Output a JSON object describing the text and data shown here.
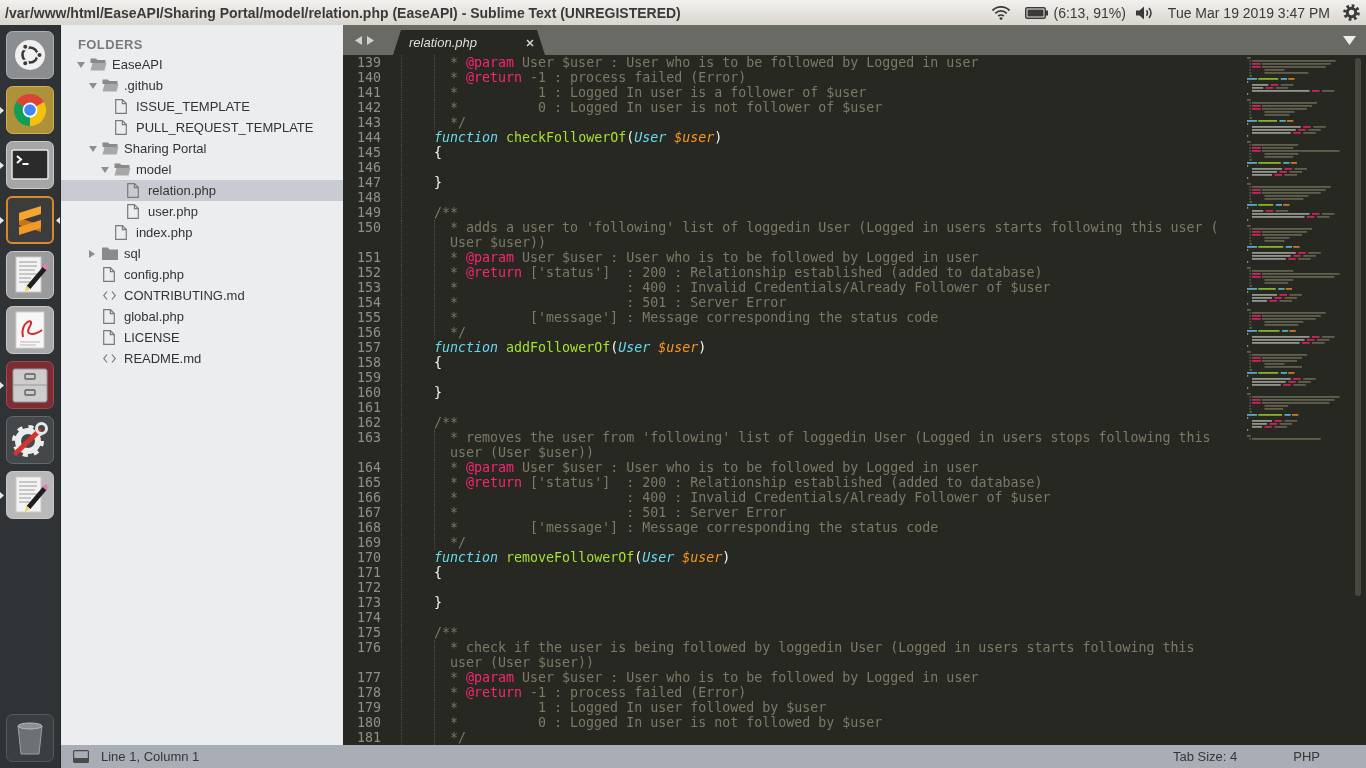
{
  "top_panel": {
    "title": "/var/www/html/EaseAPI/Sharing Portal/model/relation.php (EaseAPI) - Sublime Text (UNREGISTERED)",
    "battery": "(6:13, 91%)",
    "clock": "Tue Mar 19 2019 3:47 PM"
  },
  "launcher": {
    "items": [
      {
        "kind": "home",
        "running": false,
        "focused": false
      },
      {
        "kind": "browser",
        "running": true,
        "focused": false
      },
      {
        "kind": "terminal",
        "running": true,
        "focused": false
      },
      {
        "kind": "sublime",
        "running": true,
        "focused": true
      },
      {
        "kind": "writer",
        "running": false,
        "focused": false
      },
      {
        "kind": "reader",
        "running": false,
        "focused": false
      },
      {
        "kind": "files",
        "running": true,
        "focused": false
      },
      {
        "kind": "settings",
        "running": false,
        "focused": false
      },
      {
        "kind": "notes",
        "running": true,
        "focused": false
      },
      {
        "kind": "trash",
        "running": false,
        "focused": false
      }
    ]
  },
  "sidebar": {
    "heading": "FOLDERS",
    "tree": [
      {
        "name": "EaseAPI",
        "kind": "folder",
        "expanded": true,
        "selected": false,
        "children": [
          {
            "name": ".github",
            "kind": "folder",
            "expanded": true,
            "selected": false,
            "children": [
              {
                "name": "ISSUE_TEMPLATE",
                "kind": "file",
                "selected": false
              },
              {
                "name": "PULL_REQUEST_TEMPLATE",
                "kind": "file",
                "selected": false
              }
            ]
          },
          {
            "name": "Sharing Portal",
            "kind": "folder",
            "expanded": true,
            "selected": false,
            "children": [
              {
                "name": "model",
                "kind": "folder",
                "expanded": true,
                "selected": false,
                "children": [
                  {
                    "name": "relation.php",
                    "kind": "file",
                    "selected": true
                  },
                  {
                    "name": "user.php",
                    "kind": "file",
                    "selected": false
                  }
                ]
              },
              {
                "name": "index.php",
                "kind": "file",
                "selected": false
              }
            ]
          },
          {
            "name": "sql",
            "kind": "folder",
            "expanded": false,
            "selected": false
          },
          {
            "name": "config.php",
            "kind": "file",
            "selected": false
          },
          {
            "name": "CONTRIBUTING.md",
            "kind": "markup",
            "selected": false
          },
          {
            "name": "global.php",
            "kind": "file",
            "selected": false
          },
          {
            "name": "LICENSE",
            "kind": "file",
            "selected": false
          },
          {
            "name": "README.md",
            "kind": "markup",
            "selected": false
          }
        ]
      }
    ]
  },
  "tabs": [
    {
      "label": "relation.php",
      "selected": true
    }
  ],
  "editor": {
    "lines": [
      {
        "number": "139",
        "kind": "doc",
        "tokens": [
          {
            "kind": "comment",
            "text": "* "
          },
          {
            "kind": "tag",
            "text": "@param"
          },
          {
            "kind": "comment",
            "text": " User $user : User who is to be followed by Logged in user"
          }
        ]
      },
      {
        "number": "140",
        "kind": "doc",
        "tokens": [
          {
            "kind": "comment",
            "text": "* "
          },
          {
            "kind": "tag",
            "text": "@return"
          },
          {
            "kind": "comment",
            "text": " -1 : process failed (Error)"
          }
        ]
      },
      {
        "number": "141",
        "kind": "doc",
        "tokens": [
          {
            "kind": "comment",
            "text": "*          1 : Logged In user is a follower of $user"
          }
        ]
      },
      {
        "number": "142",
        "kind": "doc",
        "tokens": [
          {
            "kind": "comment",
            "text": "*          0 : Logged In user is not follower of $user"
          }
        ]
      },
      {
        "number": "143",
        "kind": "doc",
        "tokens": [
          {
            "kind": "comment",
            "text": "*/"
          }
        ]
      },
      {
        "number": "144",
        "kind": "code",
        "tokens": [
          {
            "kind": "keyword",
            "text": "function "
          },
          {
            "kind": "function",
            "text": "checkFollowerOf"
          },
          {
            "kind": "punctuation",
            "text": "("
          },
          {
            "kind": "type",
            "text": "User "
          },
          {
            "kind": "variable",
            "text": "$user"
          },
          {
            "kind": "punctuation",
            "text": ")"
          }
        ]
      },
      {
        "number": "145",
        "kind": "code",
        "tokens": [
          {
            "kind": "punctuation",
            "text": "{"
          }
        ]
      },
      {
        "number": "146",
        "kind": "blank"
      },
      {
        "number": "147",
        "kind": "code",
        "tokens": [
          {
            "kind": "punctuation",
            "text": "}"
          }
        ]
      },
      {
        "number": "148",
        "kind": "blank"
      },
      {
        "number": "149",
        "kind": "code",
        "tokens": [
          {
            "kind": "comment",
            "text": "/**"
          }
        ]
      },
      {
        "number": "150",
        "kind": "doc",
        "tokens": [
          {
            "kind": "comment",
            "text": "* adds a user to 'following' list of loggedin User (Logged in users starts following this user (User $user))"
          }
        ]
      },
      {
        "number": "151",
        "kind": "doc",
        "tokens": [
          {
            "kind": "comment",
            "text": "* "
          },
          {
            "kind": "tag",
            "text": "@param"
          },
          {
            "kind": "comment",
            "text": " User $user : User who is to be followed by Logged in user"
          }
        ]
      },
      {
        "number": "152",
        "kind": "doc",
        "tokens": [
          {
            "kind": "comment",
            "text": "* "
          },
          {
            "kind": "tag",
            "text": "@return"
          },
          {
            "kind": "comment",
            "text": " ['status']  : 200 : Relationship established (added to database)"
          }
        ]
      },
      {
        "number": "153",
        "kind": "doc",
        "tokens": [
          {
            "kind": "comment",
            "text": "*                     : 400 : Invalid Credentials/Already Follower of $user"
          }
        ]
      },
      {
        "number": "154",
        "kind": "doc",
        "tokens": [
          {
            "kind": "comment",
            "text": "*                     : 501 : Server Error"
          }
        ]
      },
      {
        "number": "155",
        "kind": "doc",
        "tokens": [
          {
            "kind": "comment",
            "text": "*         ['message'] : Message corresponding the status code"
          }
        ]
      },
      {
        "number": "156",
        "kind": "doc",
        "tokens": [
          {
            "kind": "comment",
            "text": "*/"
          }
        ]
      },
      {
        "number": "157",
        "kind": "code",
        "tokens": [
          {
            "kind": "keyword",
            "text": "function "
          },
          {
            "kind": "function",
            "text": "addFollowerOf"
          },
          {
            "kind": "punctuation",
            "text": "("
          },
          {
            "kind": "type",
            "text": "User "
          },
          {
            "kind": "variable",
            "text": "$user"
          },
          {
            "kind": "punctuation",
            "text": ")"
          }
        ]
      },
      {
        "number": "158",
        "kind": "code",
        "tokens": [
          {
            "kind": "punctuation",
            "text": "{"
          }
        ]
      },
      {
        "number": "159",
        "kind": "blank"
      },
      {
        "number": "160",
        "kind": "code",
        "tokens": [
          {
            "kind": "punctuation",
            "text": "}"
          }
        ]
      },
      {
        "number": "161",
        "kind": "blank"
      },
      {
        "number": "162",
        "kind": "code",
        "tokens": [
          {
            "kind": "comment",
            "text": "/**"
          }
        ]
      },
      {
        "number": "163",
        "kind": "doc",
        "tokens": [
          {
            "kind": "comment",
            "text": "* removes the user from 'following' list of loggedin User (Logged in users stops following this user (User $user))"
          }
        ]
      },
      {
        "number": "164",
        "kind": "doc",
        "tokens": [
          {
            "kind": "comment",
            "text": "* "
          },
          {
            "kind": "tag",
            "text": "@param"
          },
          {
            "kind": "comment",
            "text": " User $user : User who is to be followed by Logged in user"
          }
        ]
      },
      {
        "number": "165",
        "kind": "doc",
        "tokens": [
          {
            "kind": "comment",
            "text": "* "
          },
          {
            "kind": "tag",
            "text": "@return"
          },
          {
            "kind": "comment",
            "text": " ['status']  : 200 : Relationship established (added to database)"
          }
        ]
      },
      {
        "number": "166",
        "kind": "doc",
        "tokens": [
          {
            "kind": "comment",
            "text": "*                     : 400 : Invalid Credentials/Already Follower of $user"
          }
        ]
      },
      {
        "number": "167",
        "kind": "doc",
        "tokens": [
          {
            "kind": "comment",
            "text": "*                     : 501 : Server Error"
          }
        ]
      },
      {
        "number": "168",
        "kind": "doc",
        "tokens": [
          {
            "kind": "comment",
            "text": "*         ['message'] : Message corresponding the status code"
          }
        ]
      },
      {
        "number": "169",
        "kind": "doc",
        "tokens": [
          {
            "kind": "comment",
            "text": "*/"
          }
        ]
      },
      {
        "number": "170",
        "kind": "code",
        "tokens": [
          {
            "kind": "keyword",
            "text": "function "
          },
          {
            "kind": "function",
            "text": "removeFollowerOf"
          },
          {
            "kind": "punctuation",
            "text": "("
          },
          {
            "kind": "type",
            "text": "User "
          },
          {
            "kind": "variable",
            "text": "$user"
          },
          {
            "kind": "punctuation",
            "text": ")"
          }
        ]
      },
      {
        "number": "171",
        "kind": "code",
        "tokens": [
          {
            "kind": "punctuation",
            "text": "{"
          }
        ]
      },
      {
        "number": "172",
        "kind": "blank"
      },
      {
        "number": "173",
        "kind": "code",
        "tokens": [
          {
            "kind": "punctuation",
            "text": "}"
          }
        ]
      },
      {
        "number": "174",
        "kind": "blank"
      },
      {
        "number": "175",
        "kind": "code",
        "tokens": [
          {
            "kind": "comment",
            "text": "/**"
          }
        ]
      },
      {
        "number": "176",
        "kind": "doc",
        "tokens": [
          {
            "kind": "comment",
            "text": "* check if the user is being followed by loggedin User (Logged in users starts following this user (User $user))"
          }
        ]
      },
      {
        "number": "177",
        "kind": "doc",
        "tokens": [
          {
            "kind": "comment",
            "text": "* "
          },
          {
            "kind": "tag",
            "text": "@param"
          },
          {
            "kind": "comment",
            "text": " User $user : User who is to be followed by Logged in user"
          }
        ]
      },
      {
        "number": "178",
        "kind": "doc",
        "tokens": [
          {
            "kind": "comment",
            "text": "* "
          },
          {
            "kind": "tag",
            "text": "@return"
          },
          {
            "kind": "comment",
            "text": " -1 : process failed (Error)"
          }
        ]
      },
      {
        "number": "179",
        "kind": "doc",
        "tokens": [
          {
            "kind": "comment",
            "text": "*          1 : Logged In user followed by $user"
          }
        ]
      },
      {
        "number": "180",
        "kind": "doc",
        "tokens": [
          {
            "kind": "comment",
            "text": "*          0 : Logged In user is not followed by $user"
          }
        ]
      },
      {
        "number": "181",
        "kind": "doc",
        "tokens": [
          {
            "kind": "comment",
            "text": "*/"
          }
        ]
      }
    ]
  },
  "status_bar": {
    "position": "Line 1, Column 1",
    "tab_size": "Tab Size: 4",
    "syntax": "PHP"
  }
}
